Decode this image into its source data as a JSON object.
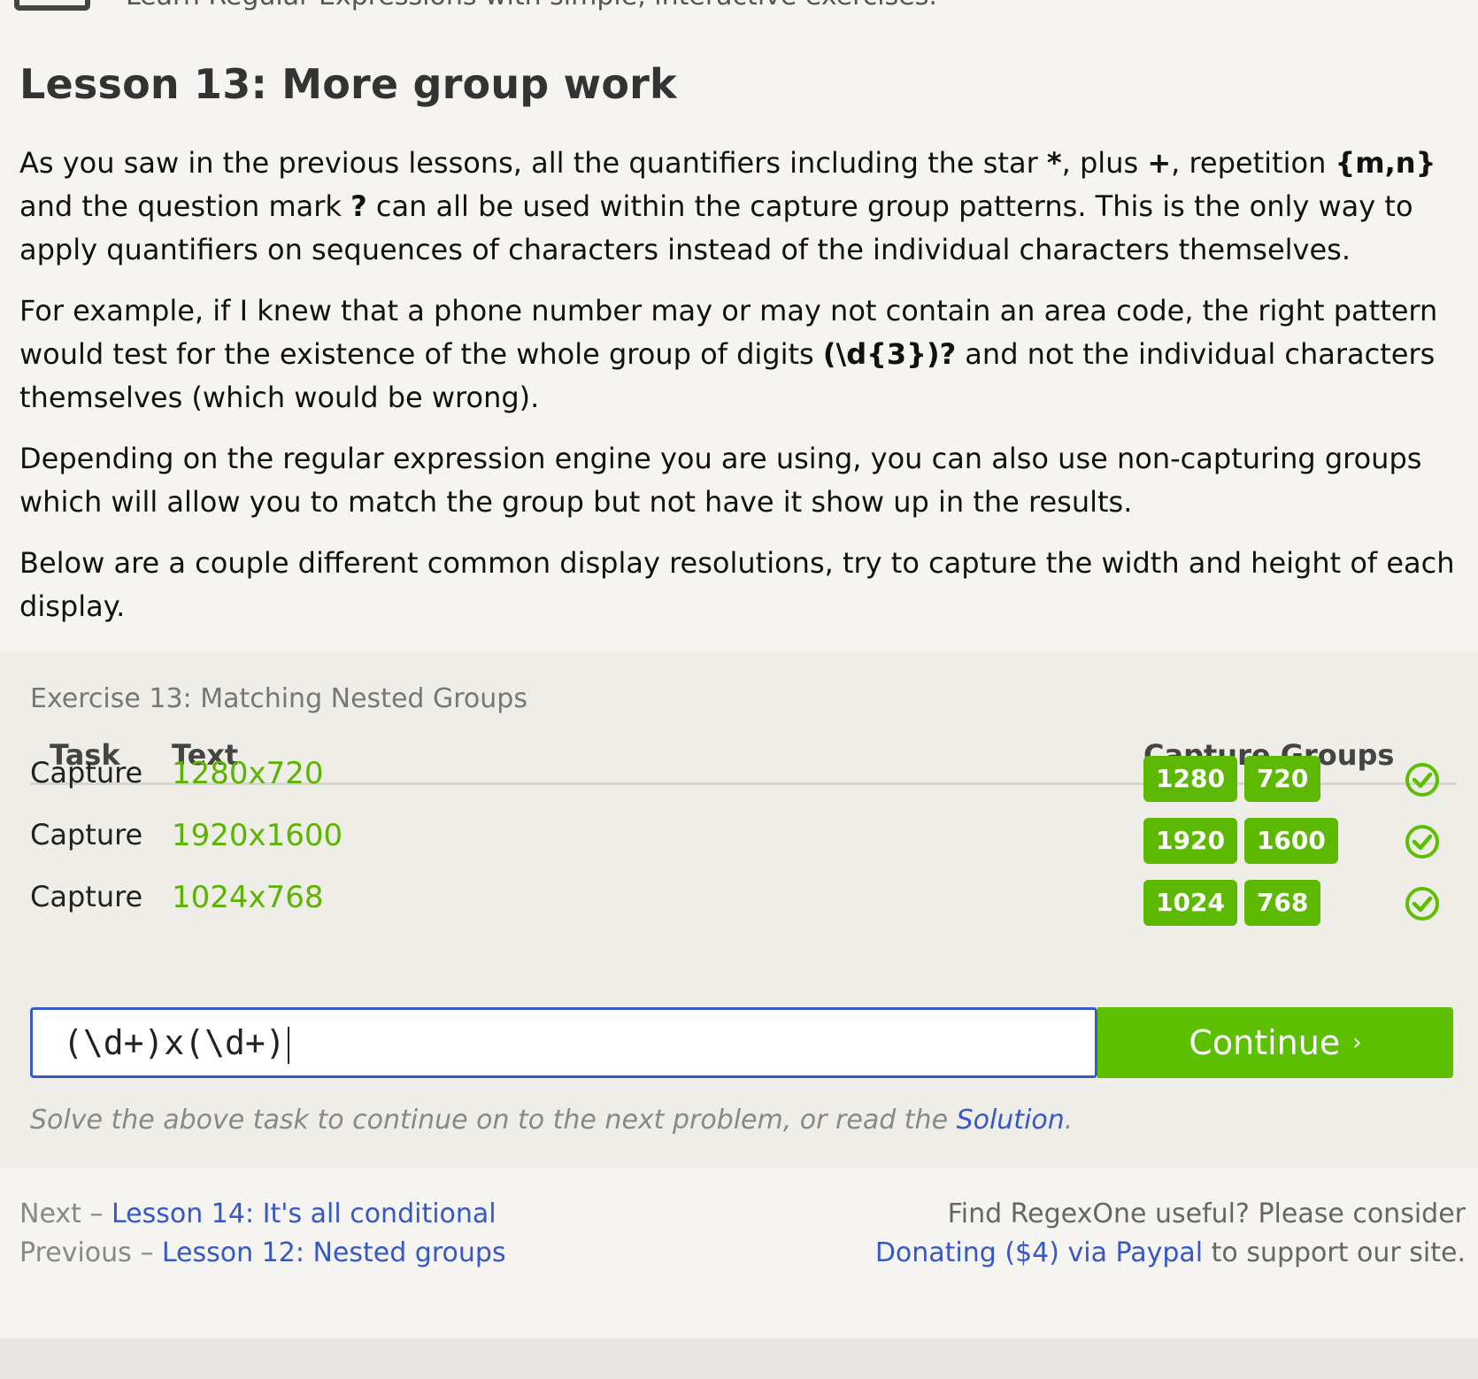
{
  "header": {
    "tagline": "Learn Regular Expressions with simple, interactive exercises."
  },
  "lesson": {
    "title": "Lesson 13: More group work",
    "p1": [
      "As you saw in the previous lessons, all the quantifiers including the star ",
      "*",
      ", plus ",
      "+",
      ", repetition ",
      "{m,n}",
      " and the question mark ",
      "?",
      " can all be used within the capture group patterns. This is the only way to apply quantifiers on sequences of characters instead of the individual characters themselves."
    ],
    "p2": [
      "For example, if I knew that a phone number may or may not contain an area code, the right pattern would test for the existence of the whole group of digits ",
      "(\\d{3})?",
      " and not the individual characters themselves (which would be wrong)."
    ],
    "p3": "Depending on the regular expression engine you are using, you can also use non-capturing groups which will allow you to match the group but not have it show up in the results.",
    "p4": "Below are a couple different common display resolutions, try to capture the width and height of each display."
  },
  "exercise": {
    "title": "Exercise 13: Matching Nested Groups",
    "columns": {
      "task": "Task",
      "text": "Text",
      "groups": "Capture Groups"
    },
    "rows": [
      {
        "task": "Capture",
        "text": "1280x720",
        "groups": [
          "1280",
          "720"
        ],
        "status_icon": "check-circle-icon"
      },
      {
        "task": "Capture",
        "text": "1920x1600",
        "groups": [
          "1920",
          "1600"
        ],
        "status_icon": "check-circle-icon"
      },
      {
        "task": "Capture",
        "text": "1024x768",
        "groups": [
          "1024",
          "768"
        ],
        "status_icon": "check-circle-icon"
      }
    ],
    "input_value": "(\\d+)x(\\d+)",
    "continue_label": "Continue",
    "continue_icon": "chevron-right-icon",
    "hint_prefix": "Solve the above task to continue on to the next problem, or read the ",
    "hint_link": "Solution",
    "hint_suffix": "."
  },
  "footer": {
    "next_prefix": "Next – ",
    "next_link": "Lesson 14: It's all conditional",
    "prev_prefix": "Previous – ",
    "prev_link": "Lesson 12: Nested groups",
    "donate_line1": "Find RegexOne useful? Please consider",
    "donate_link": "Donating ($4) via Paypal",
    "donate_suffix": " to support our site."
  },
  "colors": {
    "accent_green": "#5cbf00",
    "link_blue": "#3558c5",
    "input_border": "#3a5bc7"
  }
}
